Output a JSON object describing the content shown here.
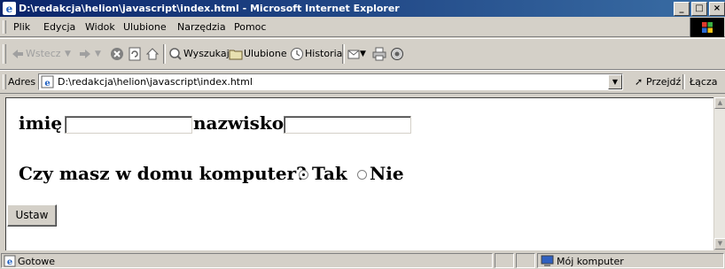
{
  "window": {
    "title": "D:\\redakcja\\helion\\javascript\\index.html - Microsoft Internet Explorer",
    "minimize": "_",
    "maximize": "□",
    "close": "×"
  },
  "menu": [
    "Plik",
    "Edycja",
    "Widok",
    "Ulubione",
    "Narzędzia",
    "Pomoc"
  ],
  "toolbar": {
    "back": "Wstecz",
    "search": "Wyszukaj",
    "favorites": "Ulubione",
    "history": "Historia"
  },
  "address": {
    "label": "Adres",
    "value": "D:\\redakcja\\helion\\javascript\\index.html",
    "go": "Przejdź",
    "links": "Łącza"
  },
  "form": {
    "first_name_label": "imię",
    "last_name_label": "nazwisko",
    "question": "Czy masz w domu komputer?",
    "option_yes": "Tak",
    "option_no": "Nie",
    "selected": "Tak",
    "submit_label": "Ustaw"
  },
  "status": {
    "text": "Gotowe",
    "zone": "Mój komputer"
  },
  "colors": {
    "title_gradient_start": "#0a246a",
    "title_gradient_end": "#3a6ea5",
    "chrome": "#d4d0c8"
  }
}
